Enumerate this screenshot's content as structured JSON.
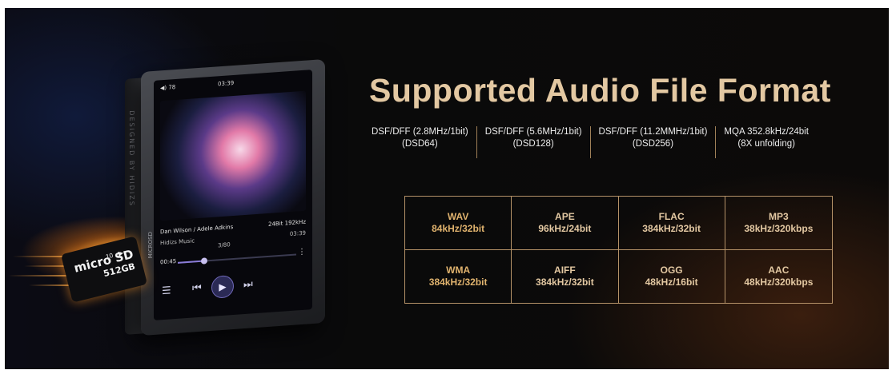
{
  "title": "Supported Audio File Format",
  "dsd_formats": [
    {
      "line1": "DSF/DFF (2.8MHz/1bit)",
      "line2": "(DSD64)"
    },
    {
      "line1": "DSF/DFF (5.6MHz/1bit)",
      "line2": "(DSD128)"
    },
    {
      "line1": "DSF/DFF (11.2MMHz/1bit)",
      "line2": "(DSD256)"
    },
    {
      "line1": "MQA 352.8kHz/24bit",
      "line2": "(8X unfolding)"
    }
  ],
  "formats": [
    {
      "name": "WAV",
      "spec": "84kHz/32bit"
    },
    {
      "name": "APE",
      "spec": "96kHz/24bit"
    },
    {
      "name": "FLAC",
      "spec": "384kHz/32bit"
    },
    {
      "name": "MP3",
      "spec": "38kHz/320kbps"
    },
    {
      "name": "WMA",
      "spec": "384kHz/32bit"
    },
    {
      "name": "AIFF",
      "spec": "384kHz/32bit"
    },
    {
      "name": "OGG",
      "spec": "48kHz/16bit"
    },
    {
      "name": "AAC",
      "spec": "48kHz/320kbps"
    }
  ],
  "device": {
    "side_label": "DESIGNED BY HIDIZS",
    "slot_label": "MICROSD",
    "status": {
      "battery": "78",
      "clock": "03:39"
    },
    "track": {
      "artist": "Dan Wilson / Adele Adkins",
      "quality": "24Bit 192kHz",
      "album": "Hidizs Music",
      "counter": "3/80",
      "duration": "03:39",
      "elapsed": "00:45",
      "progress": 0.22
    }
  },
  "sd_card": {
    "brand": "micro SD",
    "capacity": "512GB",
    "class": "10"
  },
  "colors": {
    "gold": "#e3c8a2",
    "border": "#b59268"
  }
}
